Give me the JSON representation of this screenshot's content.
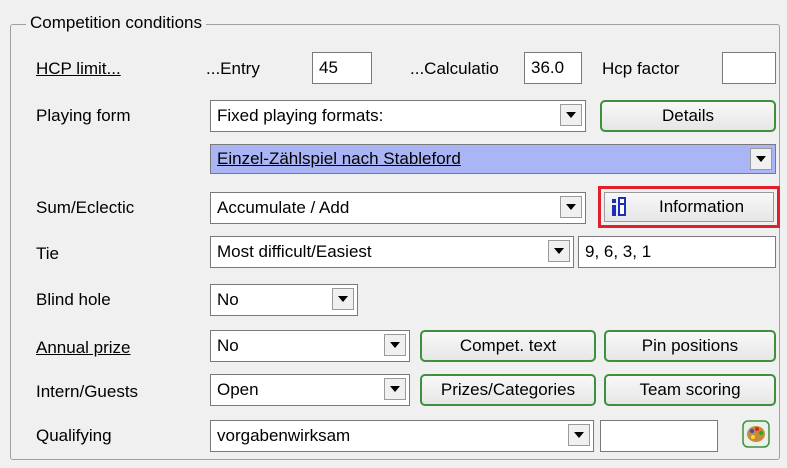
{
  "group_title": "Competition conditions",
  "labels": {
    "hcp_limit": "HCP limit...",
    "entry": "...Entry",
    "calculation": "...Calculatio",
    "hcp_factor": "Hcp factor",
    "playing_form": "Playing form",
    "sum_eclectic": "Sum/Eclectic",
    "tie": "Tie",
    "blind_hole": "Blind hole",
    "annual_prize": "Annual prize",
    "intern_guests": "Intern/Guests",
    "qualifying": "Qualifying"
  },
  "fields": {
    "entry_value": "45",
    "calculation_value": "36.0",
    "hcp_factor_value": "",
    "playing_form_value": "Fixed playing formats:",
    "format_value": "Einzel-Zählspiel nach Stableford",
    "sum_eclectic_value": "Accumulate / Add",
    "tie_value": "Most difficult/Easiest",
    "tie_holes": "9, 6, 3, 1",
    "blind_hole_value": "No",
    "annual_prize_value": "No",
    "intern_guests_value": "Open",
    "qualifying_value": "vorgabenwirksam",
    "qualifying_extra": ""
  },
  "buttons": {
    "details": "Details",
    "information": "Information",
    "compet_text": "Compet. text",
    "pin_positions": "Pin positions",
    "prizes_categories": "Prizes/Categories",
    "team_scoring": "Team scoring"
  },
  "colors": {
    "button_border": "#3e8f3e",
    "highlight": "#a9b5f5",
    "info_outline": "#e0202a"
  }
}
